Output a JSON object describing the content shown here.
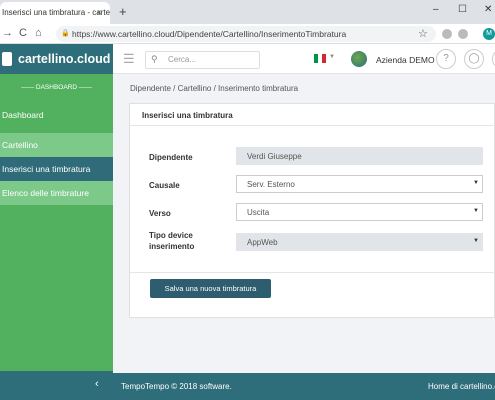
{
  "browser": {
    "tab_title": "Inserisci una timbratura - cartellino.cl",
    "tab_close": "×",
    "new_tab": "+",
    "min": "–",
    "max": "☐",
    "close": "✕",
    "back": "←",
    "forward": "→",
    "reload": "C",
    "home": "⌂",
    "url": "https://www.cartellino.cloud/Dipendente/Cartellino/InserimentoTimbratura",
    "lock": "🔒",
    "star": "☆",
    "profile": "M"
  },
  "sidebar": {
    "logo": "cartellino.cloud",
    "section": "DASHBOARD",
    "items": [
      {
        "label": "Dashboard"
      },
      {
        "label": "Cartellino"
      },
      {
        "label": "Inserisci una timbratura"
      },
      {
        "label": "Elenco delle timbrature"
      }
    ],
    "collapse": "‹"
  },
  "topbar": {
    "search_placeholder": "Cerca...",
    "company": "Azienda DEMO",
    "help": "?",
    "user": "◯"
  },
  "breadcrumb": "Dipendente / Cartellino / Inserimento timbratura",
  "form": {
    "title": "Inserisci una timbratura",
    "fields": [
      {
        "label": "Dipendente",
        "value": "Verdi Giuseppe"
      },
      {
        "label": "Causale",
        "value": "Serv. Esterno"
      },
      {
        "label": "Verso",
        "value": "Uscita"
      },
      {
        "label": "Tipo device inserimento",
        "value": "AppWeb"
      }
    ],
    "submit": "Salva una nuova timbratura"
  },
  "footer": {
    "copyright": "TempoTempo © 2018 software.",
    "home_link": "Home di cartellino.cloud"
  },
  "colors": {
    "brand": "#2e6d7a",
    "sidebar": "#52b15e",
    "active": "#2f6b79"
  }
}
